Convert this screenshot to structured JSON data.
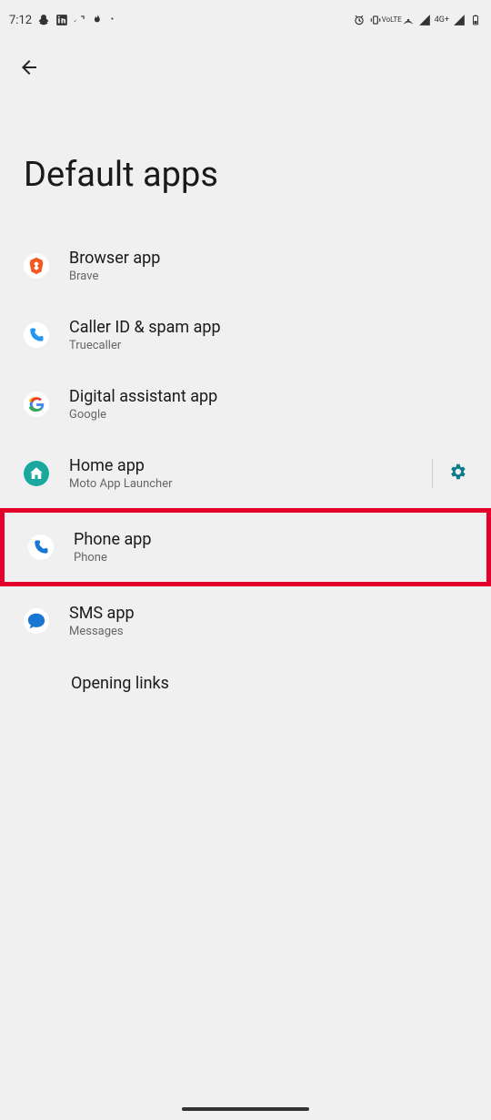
{
  "status": {
    "time": "7:12",
    "network_label": "4G+",
    "volte_label": "VoLTE"
  },
  "header": {
    "title": "Default apps"
  },
  "items": [
    {
      "title": "Browser app",
      "subtitle": "Brave",
      "icon": "brave-icon"
    },
    {
      "title": "Caller ID & spam app",
      "subtitle": "Truecaller",
      "icon": "truecaller-icon"
    },
    {
      "title": "Digital assistant app",
      "subtitle": "Google",
      "icon": "google-icon"
    },
    {
      "title": "Home app",
      "subtitle": "Moto App Launcher",
      "icon": "home-icon",
      "has_settings": true
    },
    {
      "title": "Phone app",
      "subtitle": "Phone",
      "icon": "phone-icon",
      "highlighted": true
    },
    {
      "title": "SMS app",
      "subtitle": "Messages",
      "icon": "sms-icon"
    }
  ],
  "opening_links": {
    "label": "Opening links"
  }
}
